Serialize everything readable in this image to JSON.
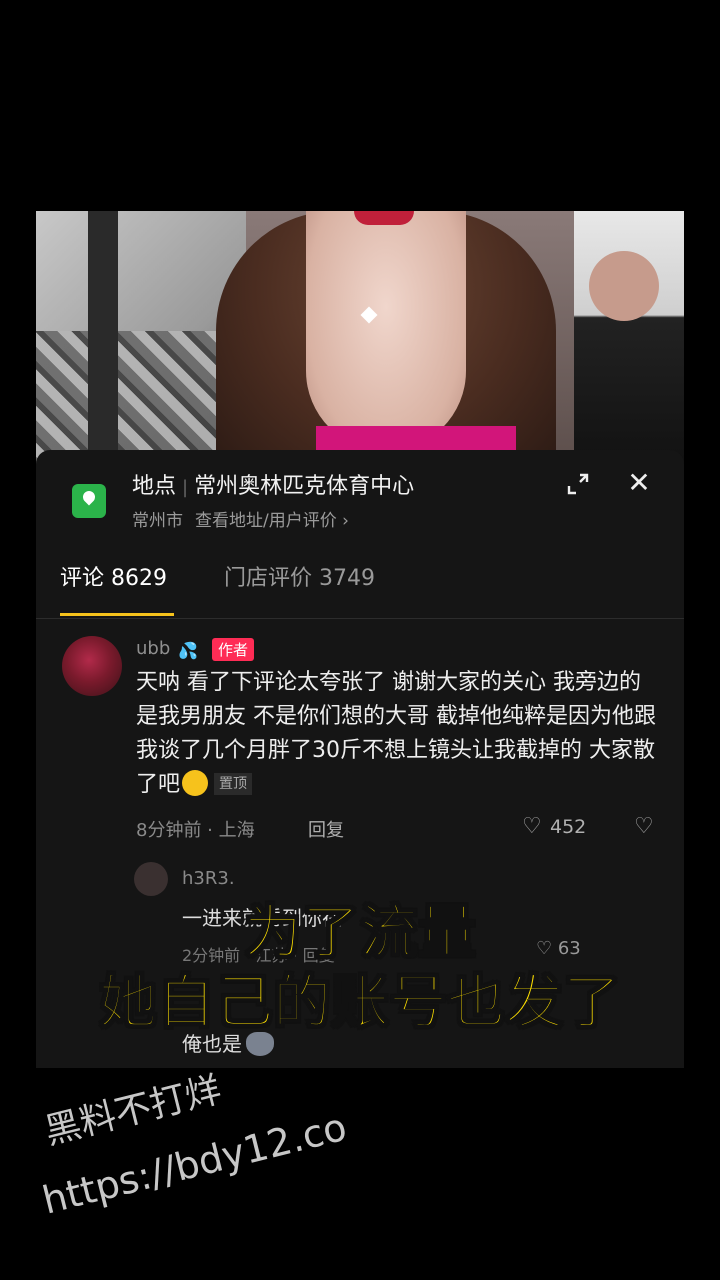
{
  "location": {
    "label": "地点",
    "name": "常州奥林匹克体育中心",
    "city": "常州市",
    "link": "查看地址/用户评价 ›"
  },
  "tabs": [
    {
      "label": "评论 8629"
    },
    {
      "label": "门店评价 3749"
    }
  ],
  "comment": {
    "user": "ubb",
    "badge": "作者",
    "text": "天呐 看了下评论太夸张了 谢谢大家的关心 我旁边的是我男朋友 不是你们想的大哥 截掉他纯粹是因为他跟我谈了几个月胖了30斤不想上镜头让我截掉的 大家散了吧",
    "pinned": "置顶",
    "meta": "8分钟前 · 上海",
    "reply": "回复",
    "likes": "452"
  },
  "replies": [
    {
      "user": "h3R3.",
      "text": "一进来就看到你在",
      "meta": "2分钟前 · 江苏 · 回复",
      "likes": "63"
    },
    {
      "text": "俺也是"
    }
  ],
  "overlay": {
    "line1": "为了流量",
    "line2": "她自己的账号也发了"
  },
  "watermark": {
    "line1": "黑料不打烊",
    "line2": "https://bdy12.co"
  },
  "colors": {
    "accent": "#f6c21c",
    "badge": "#fe2c55",
    "overlay_text": "#ffe100",
    "location_icon": "#2bb34a"
  }
}
